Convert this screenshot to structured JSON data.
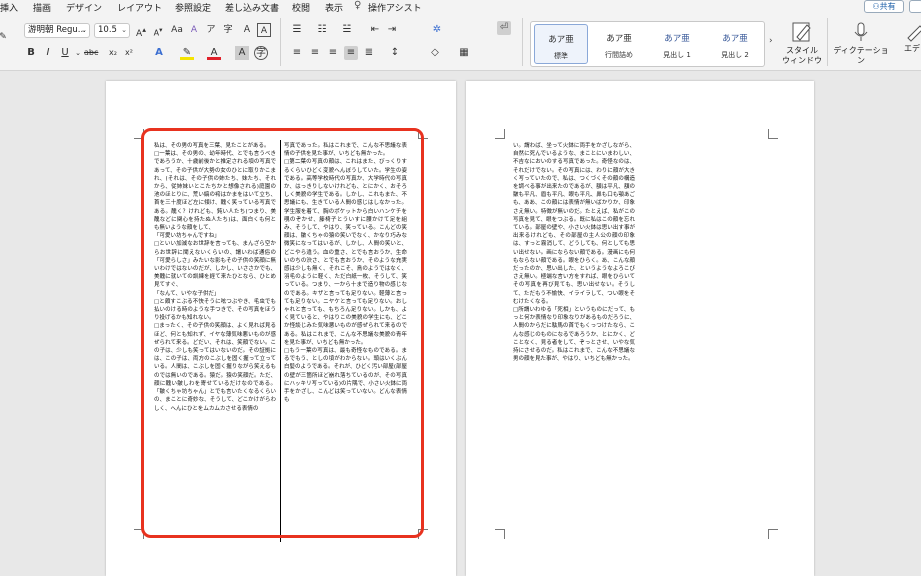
{
  "menubar": {
    "items": [
      "挿入",
      "描画",
      "デザイン",
      "レイアウト",
      "参照設定",
      "差し込み文書",
      "校閲",
      "表示",
      "操作アシスト"
    ],
    "share_label": "共有"
  },
  "ribbon": {
    "font_name": "游明朝 Regu...",
    "font_size": "10.5",
    "styles": [
      {
        "sample": "あア亜",
        "name": "標準"
      },
      {
        "sample": "あア亜",
        "name": "行間詰め"
      },
      {
        "sample": "あア亜",
        "name": "見出し 1"
      },
      {
        "sample": "あア亜",
        "name": "見出し 2"
      }
    ],
    "style_window_label": "スタイル\nウィンドウ",
    "dictation_label": "ディクテーション",
    "editor_label": "エデ"
  },
  "document": {
    "left_column_paragraphs": [
      "私は、その男の写真を三葉、見たことがある。",
      "□一葉は、その男の、幼年時代、とでも言うべきであろうか、十歳前後かと推定される頃の写真であって、その子供が大勢の女のひとに取りかこまれ、(それは、その子供の姉たち、妹たち、それから、従姉妹いとこたちかと想像される)庭園の池のほとりに、荒い縞の袴はかまをはいて立ち、首を三十度ほど左に傾け、醜く笑っている写真である。醜く？けれども、鈍い人たち(つまり、美醜などに関心を持たぬ人たち)は、面白くも何とも無いような顔をして、",
      "「可愛い坊ちゃんですね」",
      "□といい加減なお世辞を言っても、まんざら空からお世辞に聞えないくらいの、謂いわば通俗の「可愛らしさ」みたいな影もその子供の笑顔に無いわけではないのだが、しかし、いささかでも、美醜に就いての訓練を経て来たひとなら、ひとめ見てすぐ、",
      "「なんて、いやな子供だ」",
      "□と頗すこぶる不快そうに呟つぶやき、毛虫でも払いのける時のような手つきで、その写真をほうり投げるかも知れない。",
      "□まったく、その子供の笑顔は、よく見れば見るほど、何とも知れず、イヤな薄気味悪いものが感ぜられて来る。どだい、それは、笑顔でない。この子は、少しも笑ってはいないのだ。その証拠には、この子は、両方のこぶしを固く握って立っている。人間は、こぶしを固く握りながら笑えるものでは無いのである。猿だ。猿の笑顔だ。ただ、顔に醜い皺しわを寄せているだけなのである。「皺くちゃ坊ちゃん」とでも言いたくなるくらいの、まことに奇妙な、そうして、どこかけがらわしく、へんにひとをムカムカさせる表情の"
    ],
    "middle_column_paragraphs": [
      "写真であった。私はこれまで、こんな不思議な表情の子供を見た事が、いちども無かった。",
      "□第二葉の写真の顔は、これはまた、びっくりするくらいひどく変貌へんぼうしていた。学生の姿である。高等学校時代の写真か、大学時代の写真か、はっきりしないけれども、とにかく、おそろしく美貌の学生である。しかし、これもまた、不思議にも、生きている人間の感じはしなかった。学生服を着て、胸のポケットから白いハンケチを覗のぞかせ、籐椅子とういすに腰かけて足を組み、そうして、やはり、笑っている。こんどの笑顔は、皺くちゃの猿の笑いでなく、かなり巧みな微笑になってはいるが、しかし、人間の笑いと、どこやら違う。血の重さ、とでも言おうか、生命いのちの渋さ、とでも言おうか、そのような充実感は少しも無く、それこそ、鳥のようではなく、羽毛のように軽く、ただ白紙一枚、そうして、笑っている。つまり、一から十まで造り物の感じなのである。キザと言っても足りない。軽薄と言っても足りない。ニヤケと言っても足りない。おしゃれと言っても、もちろん足りない。しかも、よく見ていると、やはりこの美貌の学生にも、どこか怪談じみた気味悪いものが感ぜられて来るのである。私はこれまで、こんな不思議な美貌の青年を見た事が、いちども無かった。",
      "□もう一葉の写真は、最も奇怪なものである。まるでもう、としの頃がわからない。頭はいくぶん白髪のようである。それが、ひどく汚い部屋(部屋の壁が三箇所ほど崩れ落ちているのが、その写真にハッキリ写っている)の片隅で、小さい火鉢に両手をかざし、こんどは笑っていない。どんな表情も"
    ],
    "right_column_paragraphs": [
      "い。謂わば、坐って火鉢に両手をかざしながら、自然に死んでいるような、まことにいまわしい、不吉なにおいのする写真であった。奇怪なのは、それだけでない。その写真には、わりに顔が大きく写っていたので、私は、つくづくその顔の構造を調べる事が出来たのであるが、額は平凡、額の皺も平凡、眉も平凡、眼も平凡、鼻も口も顎あごも、ああ、この顔には表情が無いばかりか、印象さえ無い。特徴が無いのだ。たとえば、私がこの写真を見て、眼をつぶる。既に私はこの顔を忘れている。部屋の壁や、小さい火鉢は思い出す事が出来るけれども、その部屋の主人公の顔の印象は、すっと霧消して、どうしても、何としても思い出せない。画にならない顔である。漫画にも何もならない顔である。眼をひらく。あ、こんな顔だったのか、思い出した、というようなよろこびさえ無い。極端な言い方をすれば、眼をひらいてその写真を再び見ても、思い出せない。そうして、ただもう不愉快、イライラして、つい眼をそむけたくなる。",
      "□所謂いわゆる「死相」というものにだって、もっと何か表情なり印象なりがあるものだろうに、人間のからだに駄馬の首でもくっつけたなら、こんな感じのものになるであろうか、とにかく、どことなく、見る者をして、ぞっとさせ、いやな気持にさせるのだ。私はこれまで、こんな不思議な男の顔を見た事が、やはり、いちども無かった。"
    ]
  },
  "colors": {
    "highlight_border": "#e8321f",
    "ribbon_background": "#f3f3f3",
    "workspace_background": "#e8e8e8"
  }
}
